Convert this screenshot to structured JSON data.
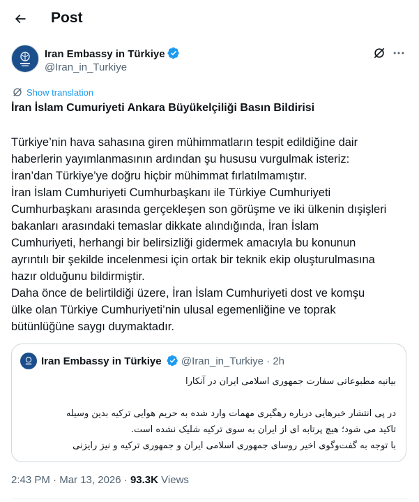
{
  "header": {
    "title": "Post",
    "back_icon": "arrow-left-icon"
  },
  "author": {
    "name": "Iran Embassy in Türkiye",
    "handle": "@Iran_in_Turkiye",
    "verified": true
  },
  "translate": {
    "label": "Show translation"
  },
  "post": {
    "title": "İran İslam Cumuriyeti Ankara Büyükelçiliği Basın Bildirisi",
    "lines": [
      "Türkiye’nin hava sahasına giren mühimmatların tespit edildiğine dair",
      "haberlerin yayımlanmasının ardından şu hususu vurgulmak isteriz:",
      "İran’dan Türkiye’ye doğru hiçbir mühimmat fırlatılmamıştır.",
      "İran İslam Cumhuriyeti Cumhurbaşkanı ile Türkiye Cumhuriyeti",
      "Cumhurbaşkanı arasında gerçekleşen son görüşme ve iki ülkenin dışişleri",
      "bakanları arasındaki temaslar dikkate alındığında, İran İslam",
      "Cumhuriyeti, herhangi bir belirsizliği gidermek amacıyla bu konunun",
      "ayrıntılı bir şekilde incelenmesi için ortak bir teknik ekip oluşturulmasına",
      "hazır olduğunu bildirmiştir.",
      "Daha önce de belirtildiği üzere, İran İslam Cumhuriyeti dost ve komşu",
      "ülke olan Türkiye Cumhuriyeti’nin ulusal egemenliğine ve toprak",
      "bütünlüğüne saygı duymaktadır."
    ]
  },
  "quote": {
    "name": "Iran Embassy in Türkiye",
    "handle": "@Iran_in_Turkiye",
    "time": "· 2h",
    "lines": [
      "بیانیه مطبوعاتی سفارت جمهوری اسلامی ایران در آنکارا",
      "",
      "در پی انتشار خبرهایی درباره رهگیری مهمات وارد شده به حریم هوایی ترکیه بدین وسیله",
      "تاکید می شود؛ هیچ پرتابه ای از ایران به سوی ترکیه شلیک نشده است.",
      "با توجه به گفت‌وگوی اخیر روسای جمهوری اسلامی ایران و جمهوری ترکیه و نیز رایزنی"
    ]
  },
  "meta": {
    "time": "2:43 PM",
    "separator": "·",
    "date": "Mar 13, 2026",
    "views_count": "93.3K",
    "views_label": "Views"
  },
  "colors": {
    "accent": "#1d9bf0",
    "text": "#0f1419",
    "muted": "#536471",
    "border": "#cfd9de"
  }
}
